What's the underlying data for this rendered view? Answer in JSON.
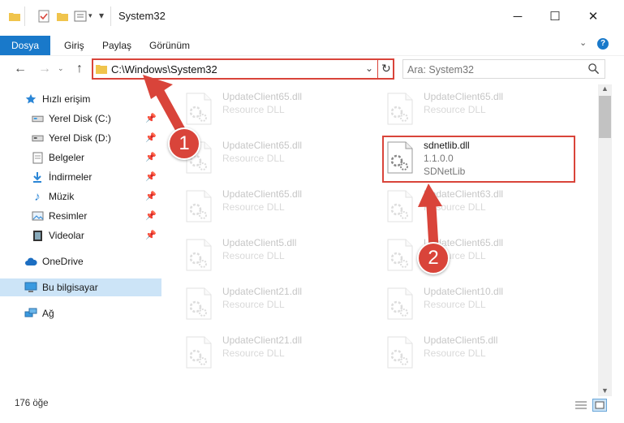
{
  "window": {
    "title": "System32"
  },
  "ribbon": {
    "tabs": [
      "Dosya",
      "Giriş",
      "Paylaş",
      "Görünüm"
    ]
  },
  "address": {
    "path": "C:\\Windows\\System32"
  },
  "search": {
    "placeholder": "Ara: System32"
  },
  "sidebar": {
    "items": [
      {
        "label": "Hızlı erişim",
        "icon": "star-icon"
      },
      {
        "label": "Yerel Disk (C:)",
        "icon": "drive-icon"
      },
      {
        "label": "Yerel Disk (D:)",
        "icon": "drive-icon"
      },
      {
        "label": "Belgeler",
        "icon": "documents-icon"
      },
      {
        "label": "İndirmeler",
        "icon": "download-icon"
      },
      {
        "label": "Müzik",
        "icon": "music-icon"
      },
      {
        "label": "Resimler",
        "icon": "pictures-icon"
      },
      {
        "label": "Videolar",
        "icon": "video-icon"
      },
      {
        "label": "OneDrive",
        "icon": "cloud-icon"
      },
      {
        "label": "Bu bilgisayar",
        "icon": "computer-icon"
      },
      {
        "label": "Ağ",
        "icon": "network-icon"
      }
    ]
  },
  "files": {
    "left": [
      {
        "name": "UpdateClient65.dll",
        "type": "Resource DLL"
      },
      {
        "name": "UpdateClient65.dll",
        "type": "Resource DLL"
      },
      {
        "name": "UpdateClient65.dll",
        "type": "Resource DLL"
      },
      {
        "name": "UpdateClient5.dll",
        "type": "Resource DLL"
      },
      {
        "name": "UpdateClient21.dll",
        "type": "Resource DLL"
      },
      {
        "name": "UpdateClient21.dll",
        "type": "Resource DLL"
      }
    ],
    "right": [
      {
        "name": "UpdateClient65.dll",
        "type": "Resource DLL"
      },
      {
        "name": "UpdateClient63.dll",
        "type": "Resource DLL"
      },
      {
        "name": "UpdateClient65.dll",
        "type": "Resource DLL"
      },
      {
        "name": "UpdateClient10.dll",
        "type": "Resource DLL"
      },
      {
        "name": "UpdateClient5.dll",
        "type": "Resource DLL"
      }
    ],
    "highlighted": {
      "name": "sdnetlib.dll",
      "version": "1.1.0.0",
      "description": "SDNetLib"
    }
  },
  "status": {
    "count": "176 öğe"
  },
  "callouts": {
    "one": "1",
    "two": "2"
  },
  "colors": {
    "accent": "#1979ca",
    "annotation": "#d9443a",
    "selected": "#cce4f7"
  }
}
